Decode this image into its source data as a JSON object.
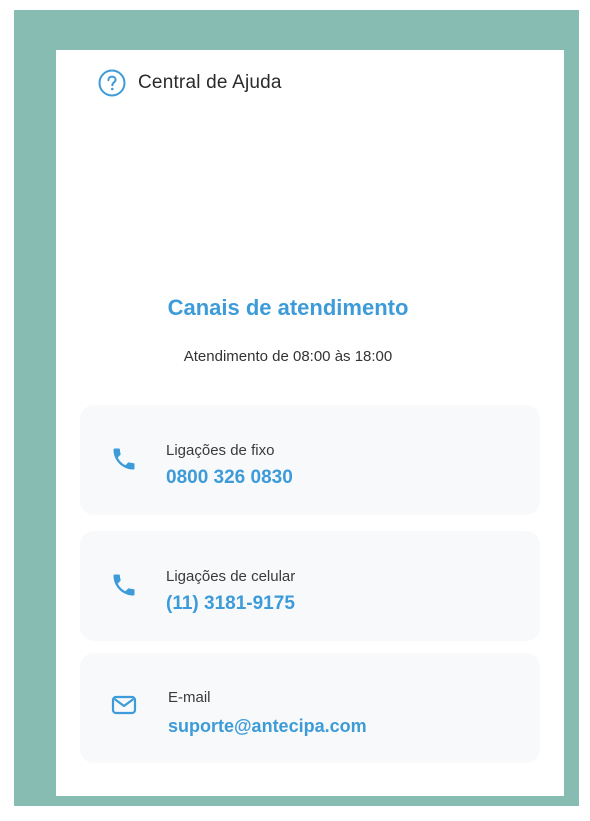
{
  "header": {
    "icon": "help-circle-icon",
    "title": "Central de Ajuda"
  },
  "main": {
    "heading": "Canais de atendimento",
    "subheading": "Atendimento de 08:00 às 18:00",
    "channels": [
      {
        "icon": "phone-icon",
        "label": "Ligações de fixo",
        "value": "0800 326 0830"
      },
      {
        "icon": "phone-icon",
        "label": "Ligações de celular",
        "value": "(11) 3181-9175"
      },
      {
        "icon": "mail-icon",
        "label": "E-mail",
        "value": "suporte@antecipa.com"
      }
    ]
  },
  "colors": {
    "frame": "#86bcb2",
    "accent": "#3c9bd8",
    "card_bg": "#ffffff",
    "channel_bg": "#f8f9fa"
  }
}
